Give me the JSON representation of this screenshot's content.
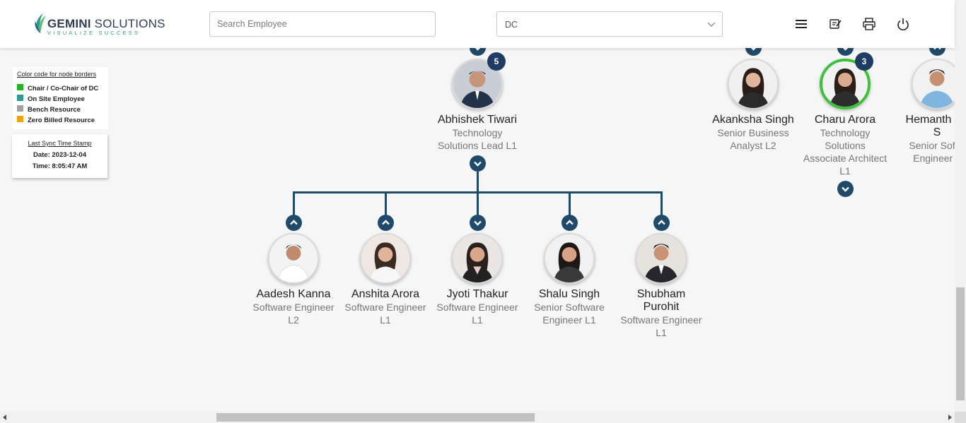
{
  "header": {
    "logo_main_bold": "GEMINI",
    "logo_main_rest": " SOLUTIONS",
    "logo_tagline": "VISUALIZE SUCCESS",
    "search_placeholder": "Search Employee",
    "select_value": "DC",
    "icons": [
      "menu-icon",
      "feedback-icon",
      "print-icon",
      "power-icon"
    ]
  },
  "legend": {
    "title": "Color code for node borders",
    "items": [
      {
        "label": "Chair / Co-Chair of DC",
        "color": "#22b522"
      },
      {
        "label": "On Site Employee",
        "color": "#2a9d9a"
      },
      {
        "label": "Bench Resource",
        "color": "#a0a0a0"
      },
      {
        "label": "Zero Billed Resource",
        "color": "#f5a300"
      }
    ]
  },
  "sync": {
    "title": "Last Sync Time Stamp",
    "date": "Date: 2023-12-04",
    "time": "Time: 8:05:47 AM"
  },
  "org": {
    "manager": {
      "name": "Abhishek Tiwari",
      "role_line1": "Technology",
      "role_line2": "Solutions Lead L1",
      "reports": "5"
    },
    "peers": [
      {
        "name": "Akanksha Singh",
        "role_line1": "Senior Business",
        "role_line2": "Analyst L2",
        "role_line3": ""
      },
      {
        "name": "Charu Arora",
        "role_line1": "Technology",
        "role_line2": "Solutions",
        "role_line3": "Associate Architect",
        "role_line4": "L1",
        "reports": "3"
      },
      {
        "name_line1": "Hemanth Ku",
        "name_line2": "S",
        "role_line1": "Senior Softw",
        "role_line2": "Engineer L"
      }
    ],
    "reports": [
      {
        "name": "Aadesh Kanna",
        "role_line1": "Software Engineer",
        "role_line2": "L2"
      },
      {
        "name": "Anshita Arora",
        "role_line1": "Software Engineer",
        "role_line2": "L1"
      },
      {
        "name": "Jyoti Thakur",
        "role_line1": "Software Engineer",
        "role_line2": "L1"
      },
      {
        "name": "Shalu Singh",
        "role_line1": "Senior Software",
        "role_line2": "Engineer L1"
      },
      {
        "name_line1": "Shubham",
        "name_line2": "Purohit",
        "role_line1": "Software Engineer",
        "role_line2": "L1"
      }
    ]
  }
}
